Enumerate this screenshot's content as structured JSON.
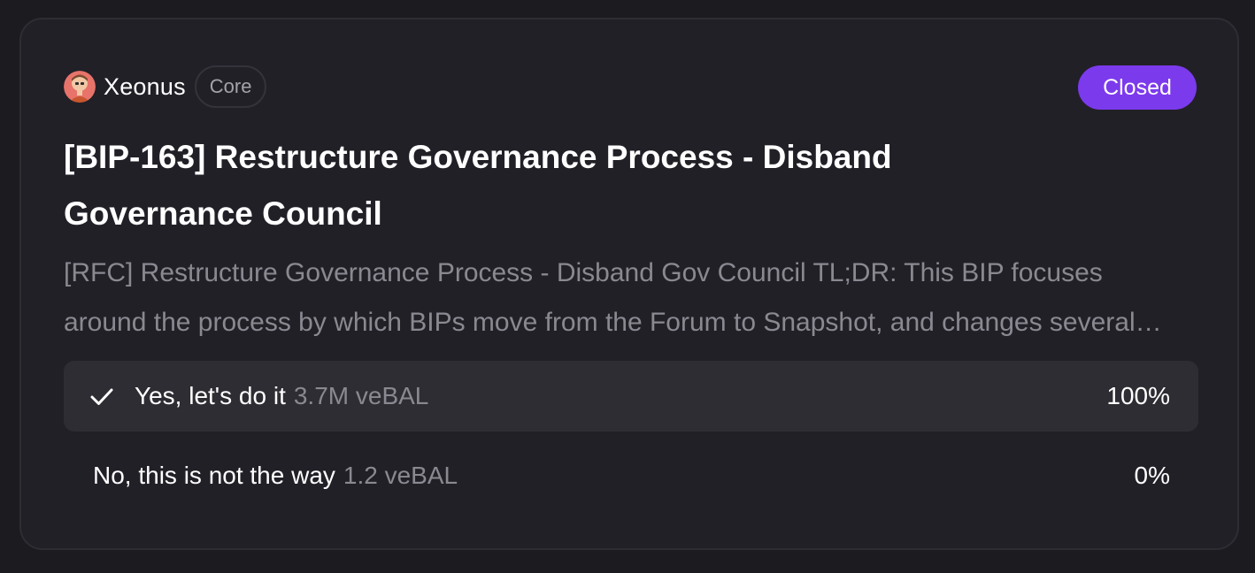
{
  "proposal": {
    "author": {
      "name": "Xeonus",
      "role": "Core",
      "avatar_icon": "author-avatar"
    },
    "status": "Closed",
    "status_color": "#7c3aed",
    "title": "[BIP-163] Restructure Governance Process - Disband Governance Council",
    "description": "[RFC] Restructure Governance Process - Disband Gov Council TL;DR: This BIP focuses around the process by which BIPs move from the Forum to Snapshot, and changes several aspects of it",
    "choices": [
      {
        "label": "Yes, let's do it",
        "votes": "3.7M veBAL",
        "percent": "100%",
        "winner": true,
        "icon": "check-icon"
      },
      {
        "label": "No, this is not the way",
        "votes": "1.2 veBAL",
        "percent": "0%",
        "winner": false
      }
    ]
  }
}
